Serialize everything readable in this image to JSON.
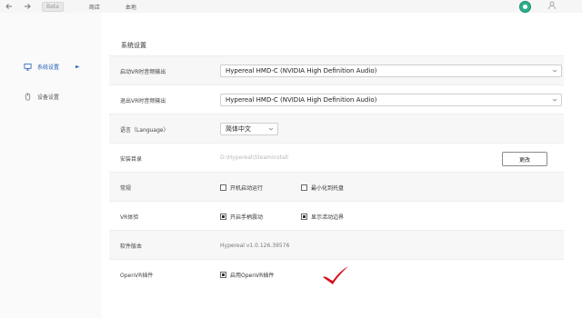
{
  "topbar": {
    "back_icon": "arrow-left-icon",
    "forward_icon": "arrow-right-icon",
    "tag_label": "Beta",
    "tab1_label": "商店",
    "tab2_label": "本地",
    "brand_icon": "brand-icon",
    "user_icon": "user-icon",
    "brand_color": "#2bb18c"
  },
  "sidebar": {
    "items": [
      {
        "label": "系统设置",
        "icon": "monitor-icon",
        "active": true
      },
      {
        "label": "设备设置",
        "icon": "mouse-icon",
        "active": false
      }
    ],
    "active_color": "#1f5fb8"
  },
  "main": {
    "section_title": "系统设置",
    "rows": [
      {
        "label": "启动VR时音频输出",
        "select_value": "Hypereal HMD-C (NVIDIA High Definition Audio)"
      },
      {
        "label": "退出VR时音频输出",
        "select_value": "Hypereal HMD-C (NVIDIA High Definition Audio)"
      },
      {
        "label": "语言（Language）",
        "select_value": "简体中文"
      },
      {
        "label": "安装目录",
        "path_value": "D:\\Hypereal\\Steaminstall",
        "button_label": "更改"
      },
      {
        "label": "常规",
        "options": [
          {
            "label": "开机启动运行",
            "checked": false
          },
          {
            "label": "最小化到托盘",
            "checked": false
          }
        ]
      },
      {
        "label": "VR体验",
        "options": [
          {
            "label": "开启手柄震动",
            "checked": true
          },
          {
            "label": "显示活动边界",
            "checked": true
          }
        ]
      },
      {
        "label": "软件版本",
        "version_value": "Hypereal v1.0.126.39576"
      },
      {
        "label": "OpenVR插件",
        "options": [
          {
            "label": "启用OpenVR插件",
            "checked": true
          }
        ]
      }
    ]
  },
  "annotation": {
    "icon": "red-checkmark-icon",
    "color": "#d0121b"
  }
}
